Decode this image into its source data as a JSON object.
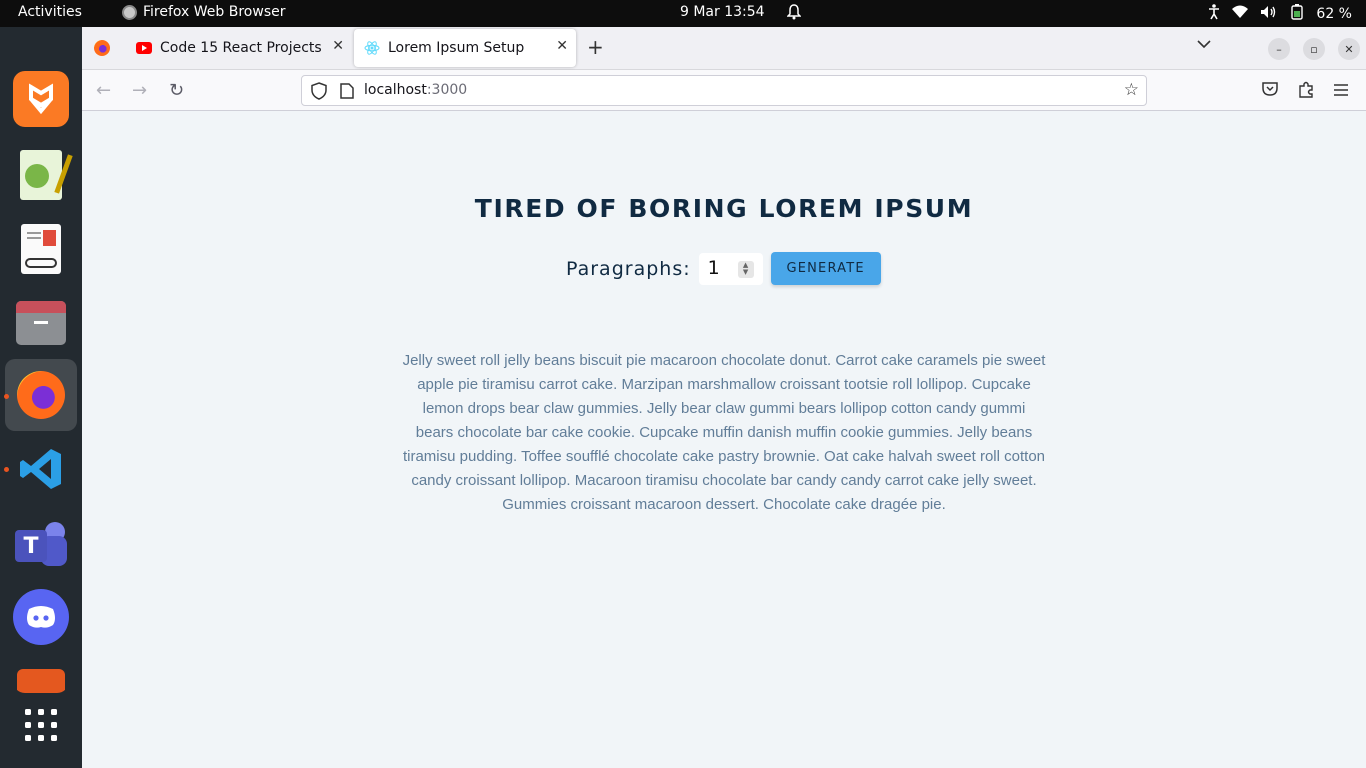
{
  "system_bar": {
    "activities": "Activities",
    "app_name": "Firefox Web Browser",
    "clock": "9 Mar  13:54",
    "battery": "62 %"
  },
  "dock": {
    "apps": [
      "xampp-icon",
      "text-editor-icon",
      "document-viewer-icon",
      "files-icon",
      "firefox-icon",
      "vscode-icon",
      "teams-icon",
      "discord-icon",
      "store-icon",
      "app-grid-icon"
    ]
  },
  "tabs": [
    {
      "title": "Code 15 React Projects -",
      "favicon": "youtube-icon"
    },
    {
      "title": "Lorem Ipsum Setup",
      "favicon": "react-icon"
    }
  ],
  "url": {
    "host": "localhost",
    "port": ":3000"
  },
  "page": {
    "heading": "TIRED OF BORING LOREM IPSUM",
    "paragraphs_label": "Paragraphs:",
    "paragraphs_value": "1",
    "generate_label": "GENERATE",
    "text": "Jelly sweet roll jelly beans biscuit pie macaroon chocolate donut. Carrot cake caramels pie sweet apple pie tiramisu carrot cake. Marzipan marshmallow croissant tootsie roll lollipop. Cupcake lemon drops bear claw gummies. Jelly bear claw gummi bears lollipop cotton candy gummi bears chocolate bar cake cookie. Cupcake muffin danish muffin cookie gummies. Jelly beans tiramisu pudding. Toffee soufflé chocolate cake pastry brownie. Oat cake halvah sweet roll cotton candy croissant lollipop. Macaroon tiramisu chocolate bar candy candy carrot cake jelly sweet. Gummies croissant macaroon dessert. Chocolate cake dragée pie."
  },
  "colors": {
    "accent": "#49a6e9",
    "heading": "#102a42",
    "text": "#617d98",
    "background": "#f1f5f8"
  }
}
